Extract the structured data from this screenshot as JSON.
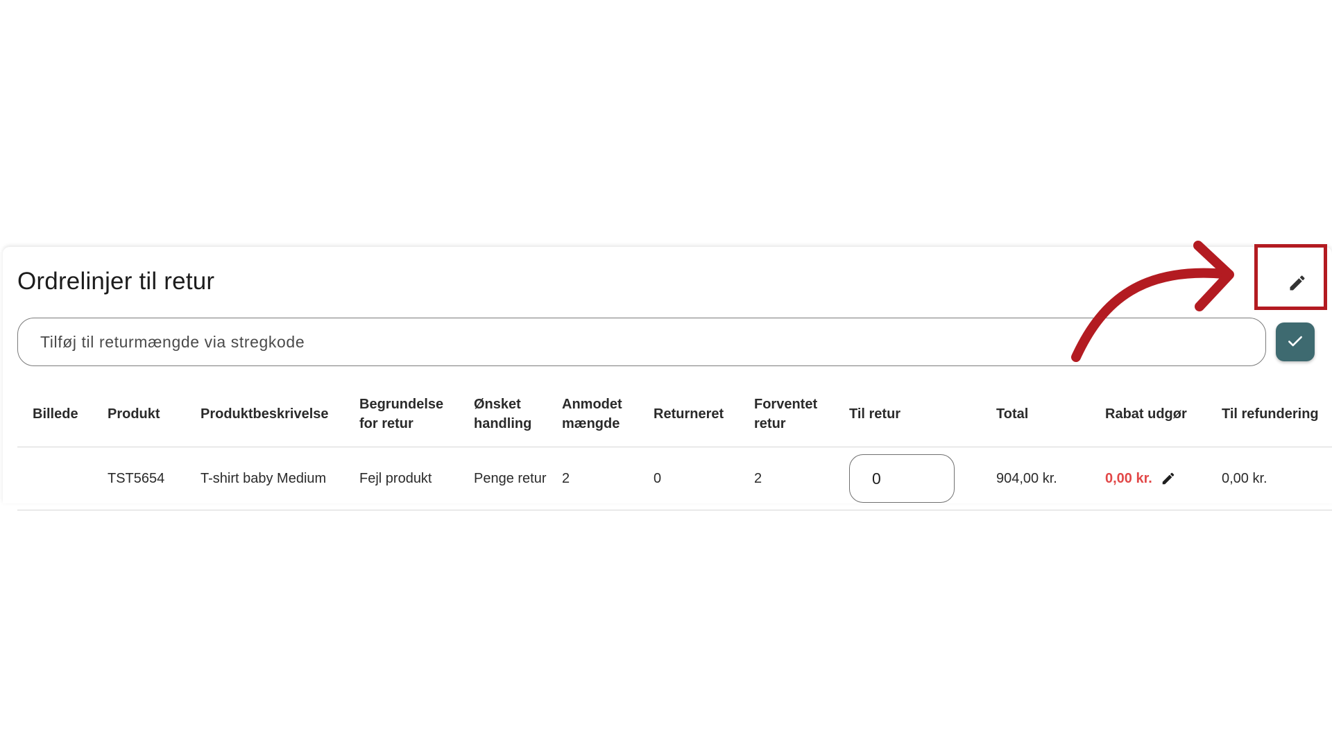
{
  "section": {
    "title": "Ordrelinjer til retur",
    "edit_icon": "pencil-icon"
  },
  "barcode": {
    "placeholder": "Tilføj til returmængde via stregkode",
    "confirm_icon": "checkmark-icon"
  },
  "table": {
    "headers": [
      "Billede",
      "Produkt",
      "Produktbeskrivelse",
      "Begrundelse for retur",
      "Ønsket handling",
      "Anmodet mængde",
      "Returneret",
      "Forventet retur",
      "Til retur",
      "Total",
      "Rabat udgør",
      "Til refundering"
    ],
    "rows": [
      {
        "image": "",
        "product": "TST5654",
        "description": "T-shirt baby Medium",
        "reason": "Fejl produkt",
        "action": "Penge retur",
        "requested": "2",
        "returned": "0",
        "expected": "2",
        "to_return": "0",
        "total": "904,00 kr.",
        "discount": "0,00 kr.",
        "refund": "0,00 kr."
      }
    ]
  },
  "colors": {
    "accent_button": "#3e6a70",
    "discount_text": "#e24848",
    "annotation": "#b31b21"
  }
}
